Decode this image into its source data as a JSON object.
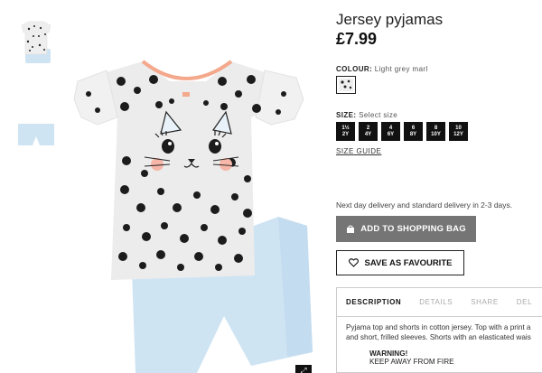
{
  "product": {
    "title": "Jersey pyjamas",
    "price": "£7.99"
  },
  "colour": {
    "label": "COLOUR:",
    "value": "Light grey marl"
  },
  "size": {
    "label": "SIZE:",
    "value": "Select size",
    "options": [
      {
        "top": "1½",
        "bottom": "2Y"
      },
      {
        "top": "2",
        "bottom": "4Y"
      },
      {
        "top": "4",
        "bottom": "6Y"
      },
      {
        "top": "6",
        "bottom": "8Y"
      },
      {
        "top": "8",
        "bottom": "10Y"
      },
      {
        "top": "10",
        "bottom": "12Y"
      }
    ],
    "guide_label": "SIZE GUIDE"
  },
  "delivery_text": "Next day delivery and standard delivery in 2-3 days.",
  "buttons": {
    "add_to_bag": "ADD TO SHOPPING BAG",
    "favourite": "SAVE AS FAVOURITE"
  },
  "tabs": [
    "DESCRIPTION",
    "DETAILS",
    "SHARE",
    "DEL"
  ],
  "description": {
    "text": "Pyjama top and shorts in cotton jersey. Top with a print a and short, frilled sleeves. Shorts with an elasticated wais",
    "warning_title": "WARNING!",
    "warning_text": "KEEP AWAY FROM FIRE"
  },
  "icons": {
    "bag": "shopping-bag-icon",
    "heart": "heart-icon"
  },
  "colors": {
    "add_bag_bg": "#757575",
    "size_btn_bg": "#111111",
    "shorts": "#cfe4f3",
    "shirt": "#efefef",
    "collar": "#f4a88c"
  }
}
